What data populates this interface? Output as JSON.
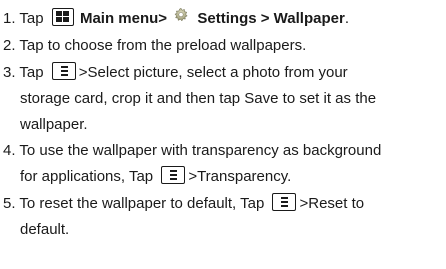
{
  "steps": [
    {
      "num": "1.",
      "pre": "Tap",
      "menu_label": "Main menu",
      "mid": ">",
      "settings_label": "Settings > Wallpaper",
      "post": "."
    },
    {
      "num": "2.",
      "text": "Tap to choose from the preload wallpapers."
    },
    {
      "num": "3.",
      "pre": "Tap",
      "post": ">Select picture, select a photo from your",
      "cont1": "storage card, crop it and then tap Save to set it as the",
      "cont2": "wallpaper."
    },
    {
      "num": "4.",
      "text": "To use the wallpaper with transparency as background",
      "cont_pre": "for applications, Tap",
      "cont_post": ">Transparency."
    },
    {
      "num": "5.",
      "pre": "To reset the wallpaper to default, Tap",
      "post": ">Reset to",
      "cont1": "default."
    }
  ],
  "icons": {
    "main_menu": "main-menu-icon",
    "settings": "gear-icon",
    "options": "options-menu-icon"
  }
}
